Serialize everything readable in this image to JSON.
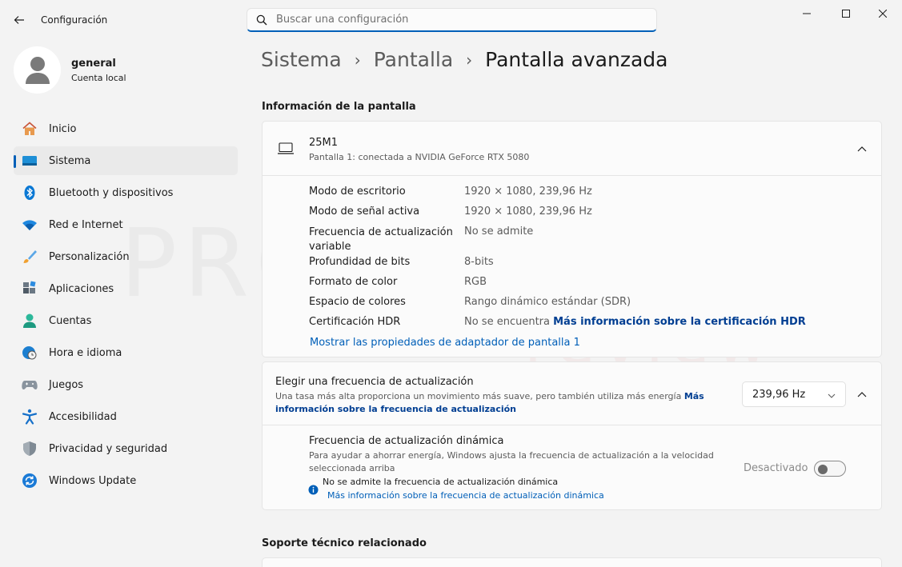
{
  "titlebar": {
    "app_title": "Configuración",
    "search_placeholder": "Buscar una configuración"
  },
  "profile": {
    "name": "general",
    "account_type": "Cuenta local"
  },
  "sidebar": {
    "items": [
      {
        "label": "Inicio",
        "icon": "home-icon"
      },
      {
        "label": "Sistema",
        "icon": "system-icon",
        "active": true
      },
      {
        "label": "Bluetooth y dispositivos",
        "icon": "bluetooth-icon"
      },
      {
        "label": "Red e Internet",
        "icon": "wifi-icon"
      },
      {
        "label": "Personalización",
        "icon": "brush-icon"
      },
      {
        "label": "Aplicaciones",
        "icon": "apps-icon"
      },
      {
        "label": "Cuentas",
        "icon": "accounts-icon"
      },
      {
        "label": "Hora e idioma",
        "icon": "clock-globe-icon"
      },
      {
        "label": "Juegos",
        "icon": "gamepad-icon"
      },
      {
        "label": "Accesibilidad",
        "icon": "accessibility-icon"
      },
      {
        "label": "Privacidad y seguridad",
        "icon": "shield-icon"
      },
      {
        "label": "Windows Update",
        "icon": "update-icon"
      }
    ]
  },
  "breadcrumb": {
    "level1": "Sistema",
    "level2": "Pantalla",
    "current": "Pantalla avanzada"
  },
  "display_info": {
    "section_title": "Información de la pantalla",
    "monitor_name": "25M1",
    "monitor_subtitle": "Pantalla 1: conectada a NVIDIA GeForce RTX 5080",
    "rows": [
      {
        "label": "Modo de escritorio",
        "value": "1920 × 1080, 239,96 Hz"
      },
      {
        "label": "Modo de señal activa",
        "value": "1920 × 1080, 239,96 Hz"
      },
      {
        "label_line1": "Frecuencia de actualización",
        "label_line2": "variable",
        "value": "No se admite"
      },
      {
        "label": "Profundidad de bits",
        "value": "8-bits"
      },
      {
        "label": "Formato de color",
        "value": "RGB"
      },
      {
        "label": "Espacio de colores",
        "value": "Rango dinámico estándar (SDR)"
      },
      {
        "label": "Certificación HDR",
        "value": "No se encuentra",
        "link": "Más información sobre la certificación HDR"
      }
    ],
    "adapter_link": "Mostrar las propiedades de adaptador de pantalla 1"
  },
  "refresh_rate": {
    "title": "Elegir una frecuencia de actualización",
    "desc": "Una tasa más alta proporciona un movimiento más suave, pero también utiliza más energía",
    "link_part1": "Más",
    "link_part2": "información sobre la frecuencia de actualización",
    "selected": "239,96 Hz"
  },
  "dynamic_refresh": {
    "title": "Frecuencia de actualización dinámica",
    "desc_line1": "Para ayudar a ahorrar energía, Windows ajusta la frecuencia de actualización a la velocidad",
    "desc_line2": "seleccionada arriba",
    "notice": "No se admite la frecuencia de actualización dinámica",
    "notice_link": "Más información sobre la frecuencia de actualización dinámica",
    "toggle_label": "Desactivado",
    "toggle_on": false
  },
  "related": {
    "section_title": "Soporte técnico relacionado"
  },
  "watermark": {
    "line1": "PROFESIONAL",
    "line2": "review"
  }
}
